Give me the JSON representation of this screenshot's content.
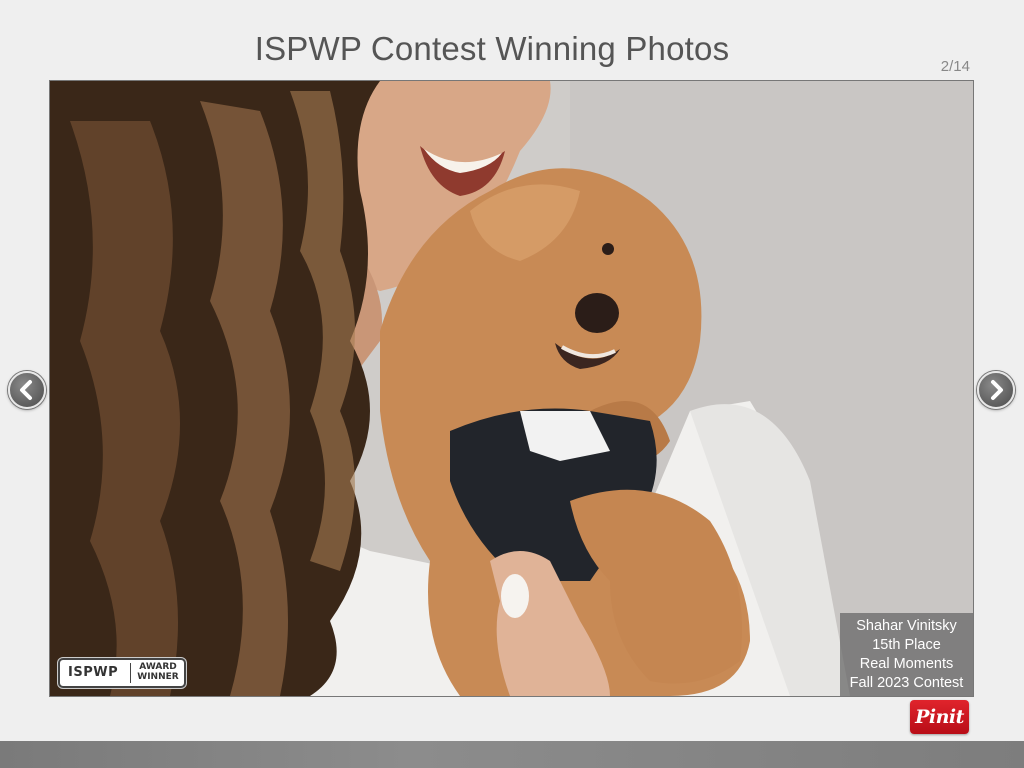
{
  "header": {
    "title": "ISPWP Contest Winning Photos",
    "counter": "2/14"
  },
  "photo": {
    "caption": {
      "photographer": "Shahar Vinitsky",
      "place": "15th Place",
      "category": "Real Moments",
      "contest": "Fall 2023 Contest"
    },
    "badge": {
      "brand": "ISPWP",
      "line1": "AWARD",
      "line2": "WINNER"
    }
  },
  "nav": {
    "prev_icon": "chevron-left-icon",
    "next_icon": "chevron-right-icon"
  },
  "pin": {
    "label": "Pinit"
  },
  "colors": {
    "pin_red": "#cb1f27",
    "caption_bg": "#646464",
    "title_text": "#555555"
  }
}
